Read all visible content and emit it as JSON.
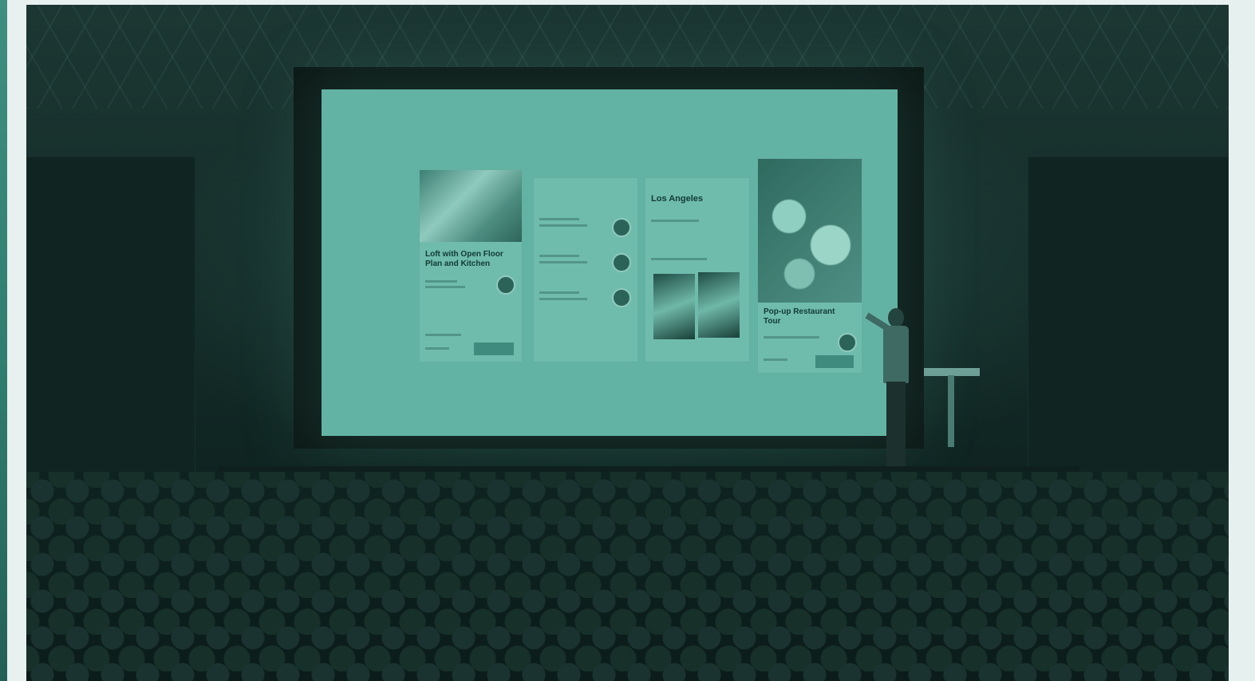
{
  "photo": {
    "description_alt": "Presenter on stage in front of a large projection screen showing app UI cards, with a seated audience in the foreground",
    "tint_color": "#63b3a4"
  },
  "screen": {
    "cards": [
      {
        "title": "Loft with Open Floor Plan and Kitchen"
      },
      {
        "title": ""
      },
      {
        "title": "Los Angeles"
      },
      {
        "title": "Pop-up Restaurant Tour"
      }
    ]
  }
}
